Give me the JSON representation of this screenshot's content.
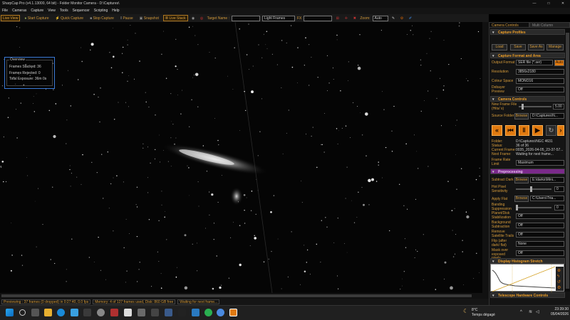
{
  "window": {
    "title": "SharpCap Pro (v4.1.13000, 64 bit) - Folder Monitor Camera - D:\\Captures\\",
    "controls": [
      "—",
      "□",
      "✕"
    ]
  },
  "menu": [
    "File",
    "Cameras",
    "Capture",
    "View",
    "Tools",
    "Sequencer",
    "Scripting",
    "Help"
  ],
  "toolbar": {
    "live_view": "Live View",
    "start_capture": "Start Capture",
    "quick_capture": "Quick Capture",
    "stop_capture": "Stop Capture",
    "pause": "Pause",
    "snapshot": "Snapshot",
    "live_stack": "Live Stack",
    "target_name_label": "Target Name :",
    "target_name_value": "",
    "light_frames": "Light Frames",
    "fx_label": "FX",
    "zoom_label": "Zoom:",
    "zoom_value": "Auto"
  },
  "overview": {
    "heading": "Overview",
    "frames_stacked": "Frames Stacked:  36",
    "frames_rejected": "Frames Rejected: 0",
    "total_exposure": "Total Exposure:   36m 0s"
  },
  "status": {
    "previewing": "Previewing : 37 frames (0 dropped) in 0:27:40, 0.0 fps",
    "memory": "Memory: 4 of 127 frames used, Disk: 860 GB free",
    "waiting": "Waiting for next frame..."
  },
  "panel": {
    "tabs": [
      "Camera Controls",
      "Multi Column"
    ],
    "capture_profiles": {
      "title": "Capture Profiles",
      "buttons": [
        "Load",
        "Save",
        "Save As",
        "Manage"
      ]
    },
    "capture_format": {
      "title": "Capture Format and Area",
      "output_format_label": "Output Format",
      "output_format_value": "SER file (*.ser)",
      "auto_label": "Auto",
      "resolution_label": "Resolution",
      "resolution_value": "3856x2180",
      "colour_space_label": "Colour Space",
      "colour_space_value": "MONO16",
      "debayer_label": "Debayer Preview",
      "debayer_value": "Off"
    },
    "camera_controls": {
      "title": "Camera Controls",
      "new_frame_label": "New Frame File (Hits/ s)",
      "new_frame_value": "5.00",
      "source_folder_label": "Source Folder",
      "browse_label": "Browse",
      "source_folder_value": "D:\\Captures\\N...",
      "folder_label": "Folder:",
      "folder_value": "D:\\Captures\\NGC 4631",
      "status_label": "Status:",
      "status_value": "36 of 36",
      "current_frame_label": "Current Frame:",
      "current_frame_value": "0035_2026-04-05_23-37-57...",
      "next_frame_label": "Next Frame:",
      "next_frame_value": "Waiting for next frame...",
      "frame_rate_label": "Frame Rate Limit",
      "frame_rate_value": "Maximum"
    },
    "preprocessing": {
      "title": "Preprocessing",
      "subtract_dark_label": "Subtract Dark",
      "subtract_dark_value": "E:\\darks\\Mini...",
      "hot_pixel_label": "Hot Pixel Sensitivity",
      "hot_pixel_value": "0",
      "apply_flat_label": "Apply Flat",
      "apply_flat_value": "C:\\Users\\Tria...",
      "banding_label": "Banding Suppression",
      "banding_value": "0",
      "planet_label": "Planet/Disk Stabilization",
      "planet_value": "Off",
      "background_label": "Background Subtraction",
      "background_value": "Off",
      "satellite_label": "Remove Satellite Trails",
      "satellite_value": "Off",
      "flip_label": "Flip (after dark/ flat)",
      "flip_value": "None",
      "mask_label": "Mask over exposed pixels",
      "mask_value": "Off"
    },
    "histogram": {
      "title": "Display Histogram Stretch"
    },
    "telescope": {
      "title": "Telescope Hardware Controls"
    }
  },
  "taskbar": {
    "weather_temp": "8°C",
    "weather_desc": "Temps dégagé",
    "time": "23:39:30",
    "date": "05/04/2026"
  },
  "colors": {
    "accent": "#e07a10",
    "label": "#d49a3a",
    "preprocessing": "#7a2a8a",
    "overview_border": "#3a7ad8"
  }
}
